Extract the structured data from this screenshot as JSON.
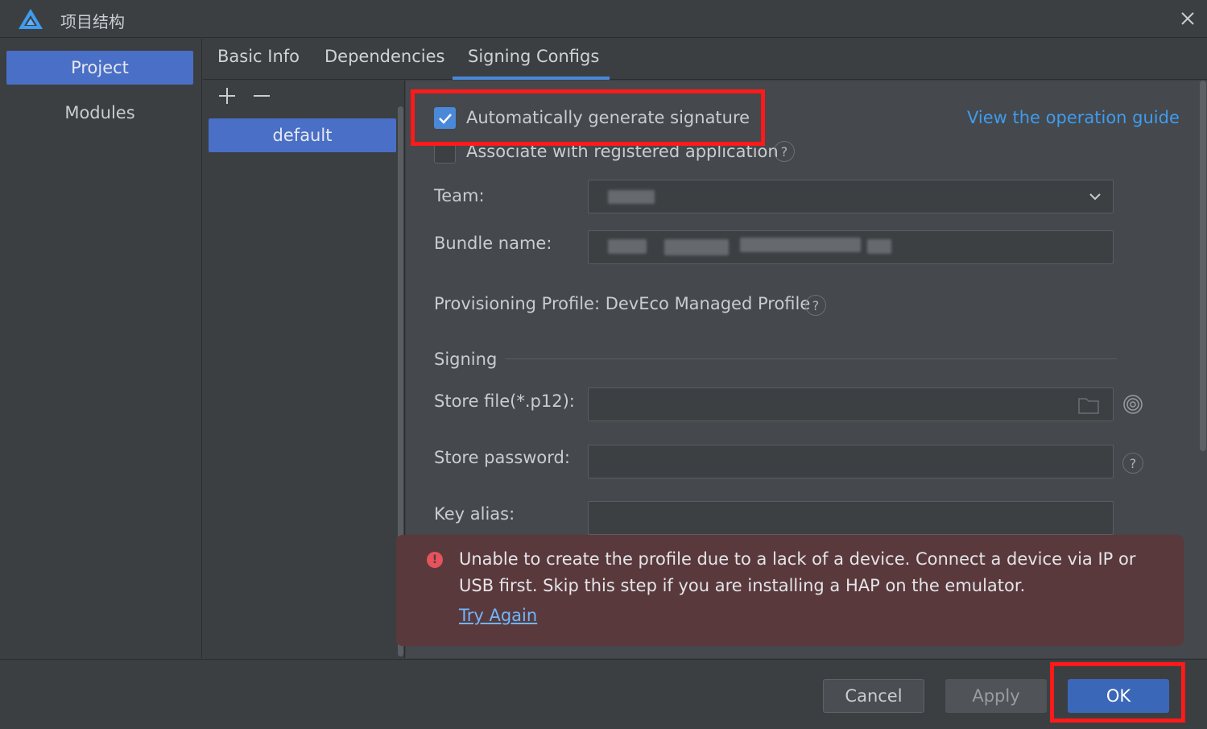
{
  "window": {
    "title": "项目结构",
    "logo_icon": "deveco-logo-icon",
    "close_icon": "close-icon"
  },
  "nav": {
    "items": [
      {
        "label": "Project",
        "active": true
      },
      {
        "label": "Modules",
        "active": false
      }
    ]
  },
  "tabs": [
    {
      "label": "Basic Info",
      "active": false
    },
    {
      "label": "Dependencies",
      "active": false
    },
    {
      "label": "Signing Configs",
      "active": true
    }
  ],
  "configs": {
    "add_icon": "plus-icon",
    "remove_icon": "minus-icon",
    "items": [
      "default"
    ]
  },
  "signing": {
    "auto_generate_label": "Automatically generate signature",
    "auto_generate_checked": true,
    "associate_label": "Associate with registered application",
    "associate_checked": false,
    "guide_link": "View the operation guide",
    "team_label": "Team:",
    "bundle_label": "Bundle name:",
    "profile_label": "Provisioning Profile: DevEco Managed Profile",
    "section_title": "Signing",
    "store_file_label": "Store file(*.p12):",
    "store_password_label": "Store password:",
    "key_alias_label": "Key alias:",
    "help_glyph": "?"
  },
  "toast": {
    "message": "Unable to create the profile due to a lack of a device. Connect a device via IP or USB first. Skip this step if you are installing a HAP on the emulator.",
    "link": "Try Again",
    "icon_glyph": "!"
  },
  "footer": {
    "cancel": "Cancel",
    "apply": "Apply",
    "ok": "OK"
  },
  "colors": {
    "accent": "#4a6fc7",
    "link": "#3f9cf0",
    "error": "#e5535c",
    "highlight": "#ff1a1a"
  }
}
